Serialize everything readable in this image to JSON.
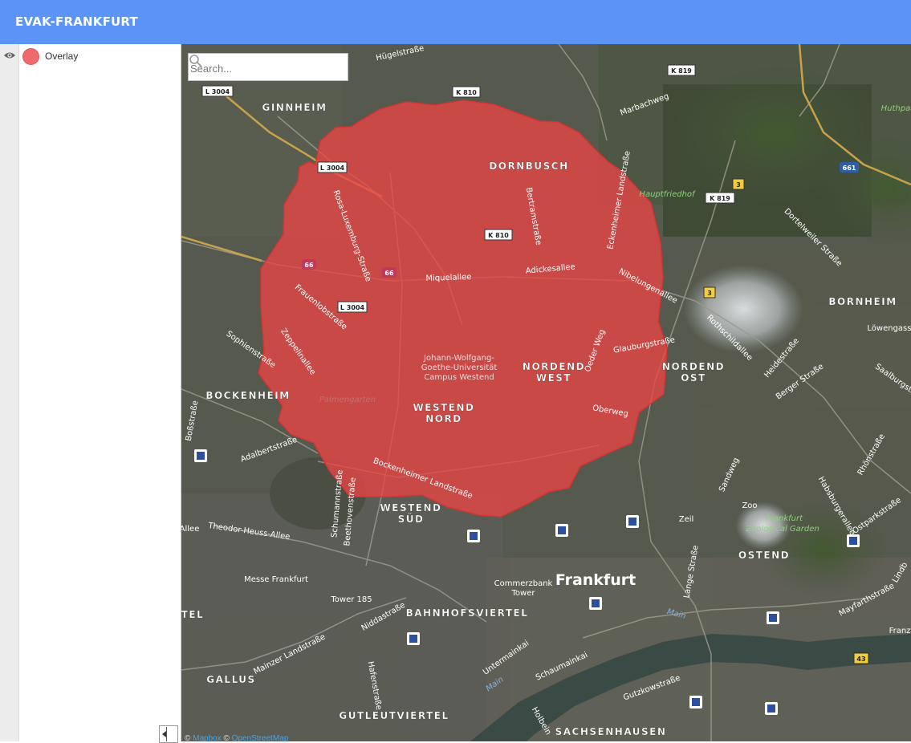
{
  "app": {
    "title": "EVAK-FRANKFURT"
  },
  "layers": [
    {
      "label": "Overlay",
      "color": "#ef6a6a"
    }
  ],
  "search": {
    "placeholder": "Search..."
  },
  "overlay": {
    "fill": "#e94545",
    "stroke": "#d83434"
  },
  "attribution": {
    "sep1": "© ",
    "mapbox": "Mapbox",
    "sep2": " © ",
    "osm": "OpenStreetMap"
  },
  "map": {
    "districts": [
      "GINNHEIM",
      "DORNBUSCH",
      "BORNHEIM",
      "NORDEND",
      "OST",
      "NORDEND",
      "WEST",
      "BOCKENHEIM",
      "WESTEND",
      "NORD",
      "WESTEND",
      "SÜD",
      "OSTEND",
      "GALLUS",
      "BAHNHOFSVIERTEL",
      "GUTLEUTVIERTEL",
      "SACHSENHAUSEN",
      "TEL"
    ],
    "city": "Frankfurt",
    "streets": [
      "Hügelstraße",
      "Marbachweg",
      "Miquelallee",
      "Adickesallee",
      "Nibelungenallee",
      "Rothschildallee",
      "Eckenheimer Landstraße",
      "Bertramstraße",
      "Rosa-Luxemburg-Straße",
      "Frauenlobstraße",
      "Zeppelinallee",
      "Sophienstraße",
      "Adalbertstraße",
      "Bockenheimer Landstraße",
      "Theodor-Heuss-Allee",
      "Mainzer Landstraße",
      "Untermainkai",
      "Schaumainkai",
      "Habsburgerallee",
      "Berger Straße",
      "Dortelweiler Straße",
      "Heidestraße",
      "Löwengasse",
      "Saalburgstraße",
      "Rhönstraße",
      "Ostparkstraße",
      "Mayfarthstraße",
      "Lange Straße",
      "Sandweg",
      "Glauburgstraße",
      "Oeder Weg",
      "Oberweg",
      "Zeil",
      "Gutzkowstraße",
      "Holbein",
      "Niddastraße",
      "Hafenstraße",
      "Schumannstraße",
      "Beethovenstraße",
      "Allee",
      "Main",
      "Main",
      "Lindb",
      "Franz",
      "Boßstraße"
    ],
    "pois": [
      "Hauptfriedhof",
      "Huthpar",
      "Johann-Wolfgang-",
      "Goethe-Universität",
      "Campus Westend",
      "Palmengarten",
      "Messe Frankfurt",
      "Tower 185",
      "Commerzbank",
      "Tower",
      "Zoo",
      "Frankfurt",
      "Zoological Garden"
    ],
    "shields": [
      "L 3004",
      "K 810",
      "K 819",
      "661",
      "3",
      "K 819",
      "L 3004",
      "K 810",
      "66",
      "66",
      "L 3004",
      "3",
      "43"
    ]
  }
}
